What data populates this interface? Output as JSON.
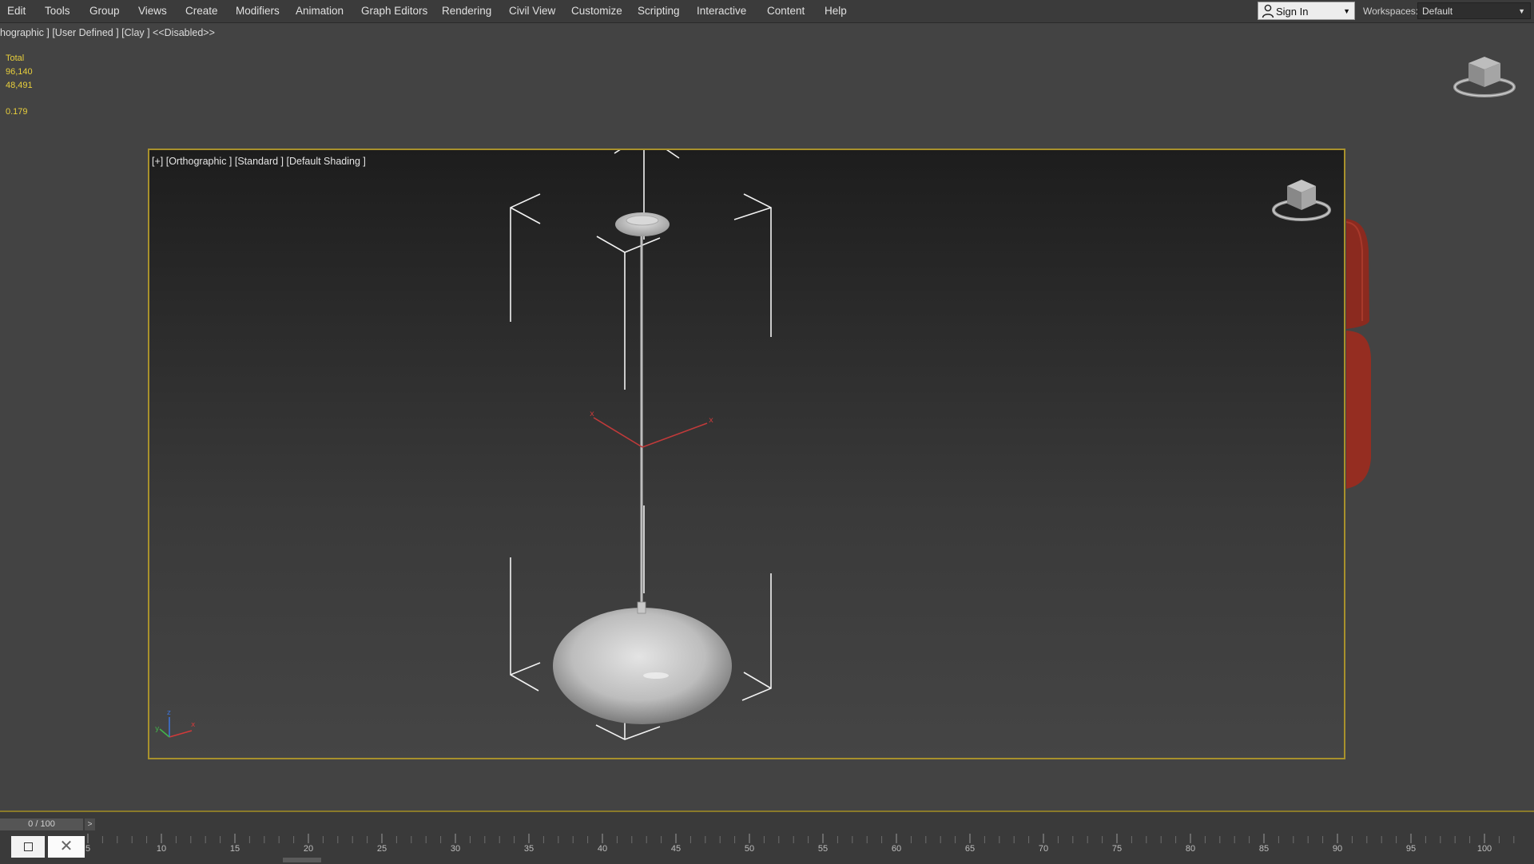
{
  "menu": {
    "items": [
      "Edit",
      "Tools",
      "Group",
      "Views",
      "Create",
      "Modifiers",
      "Animation",
      "Graph Editors",
      "Rendering",
      "Civil View",
      "Customize",
      "Scripting",
      "Interactive",
      "Content",
      "Help"
    ]
  },
  "account": {
    "sign_in_label": "Sign In",
    "workspaces_label": "Workspaces:",
    "workspace_value": "Default"
  },
  "outer_viewport": {
    "label": "hographic ] [User Defined ] [Clay ]  <<Disabled>>",
    "stats": {
      "title": "Total",
      "polys": "96,140",
      "verts": "48,491",
      "fps": "0.179"
    }
  },
  "viewport": {
    "label": "[+] [Orthographic ] [Standard ] [Default Shading ]"
  },
  "timeline": {
    "frame_display": "0 / 100",
    "next_glyph": ">",
    "close_glyph": "✕",
    "first_visible_label": "5",
    "tick_labels": [
      "10",
      "15",
      "20",
      "25",
      "30",
      "35",
      "40",
      "45",
      "50",
      "55",
      "60",
      "65",
      "70",
      "75",
      "80",
      "85",
      "90",
      "95",
      "100"
    ]
  },
  "colors": {
    "selection_border": "#a8912c",
    "stats_text": "#e8cf3c",
    "axis_red": "#c03a3a",
    "sofa_red": "#8b2a1f"
  },
  "icons": {
    "view_cube": "view-cube-icon",
    "axis_tripod": "axis-tripod-icon",
    "user": "user-icon"
  }
}
